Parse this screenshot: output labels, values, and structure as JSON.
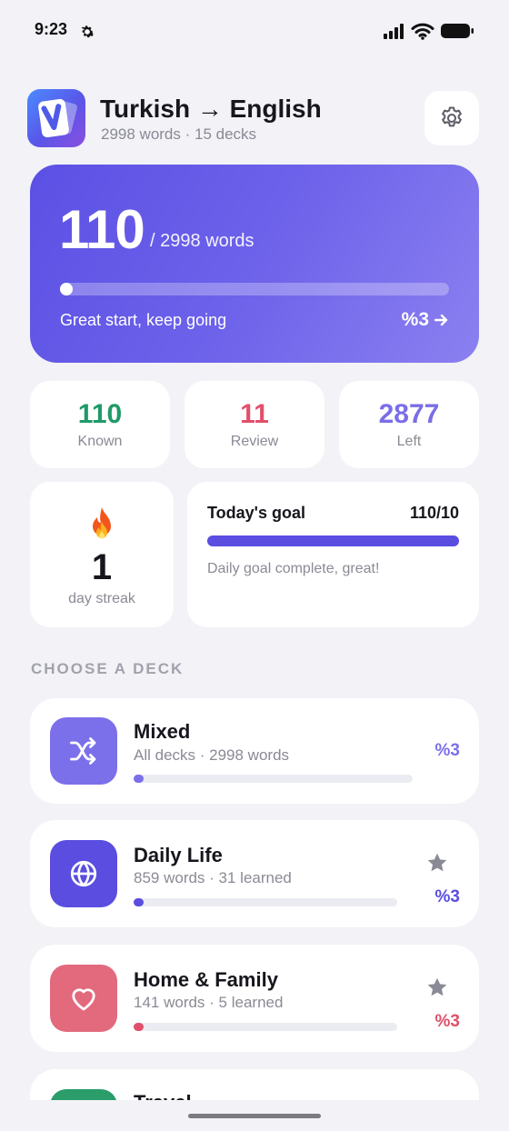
{
  "status_bar": {
    "time": "9:23"
  },
  "header": {
    "title": "Turkish → English",
    "subtitle": "2998 words · 15 decks",
    "app_icon": "V"
  },
  "hero": {
    "known": "110",
    "total_label": "/ 2998 words",
    "progress_fraction": 0.037,
    "message": "Great start, keep going",
    "percent": "%3"
  },
  "stats": [
    {
      "value": "110",
      "label": "Known",
      "color": "#1f9a68"
    },
    {
      "value": "11",
      "label": "Review",
      "color": "#e0506a"
    },
    {
      "value": "2877",
      "label": "Left",
      "color": "#7a6ee6"
    }
  ],
  "streak": {
    "icon": "flame-icon",
    "value": "1",
    "label": "day streak"
  },
  "goal": {
    "title": "Today's goal",
    "count": "110/10",
    "progress_fraction": 1.0,
    "message": "Daily goal complete, great!"
  },
  "section_title": "CHOOSE A DECK",
  "decks": [
    {
      "name": "Mixed",
      "meta": "All decks · 2998 words",
      "percent": "%3",
      "progress_fraction": 0.03,
      "color": "#7b70ea",
      "icon": "shuffle-icon",
      "starred": false
    },
    {
      "name": "Daily Life",
      "meta": "859 words · 31 learned",
      "percent": "%3",
      "progress_fraction": 0.03,
      "color": "#5a4de0",
      "icon": "globe-icon",
      "starred": true
    },
    {
      "name": "Home & Family",
      "meta": "141 words · 5 learned",
      "percent": "%3",
      "progress_fraction": 0.03,
      "color": "#e0506a",
      "icon": "heart-icon",
      "starred": true
    },
    {
      "name": "Travel",
      "color": "#2a9d6a",
      "icon": "deck-icon",
      "starred": true
    }
  ],
  "colors": {
    "accent": "#5a4de0",
    "background": "#f2f2f7"
  }
}
